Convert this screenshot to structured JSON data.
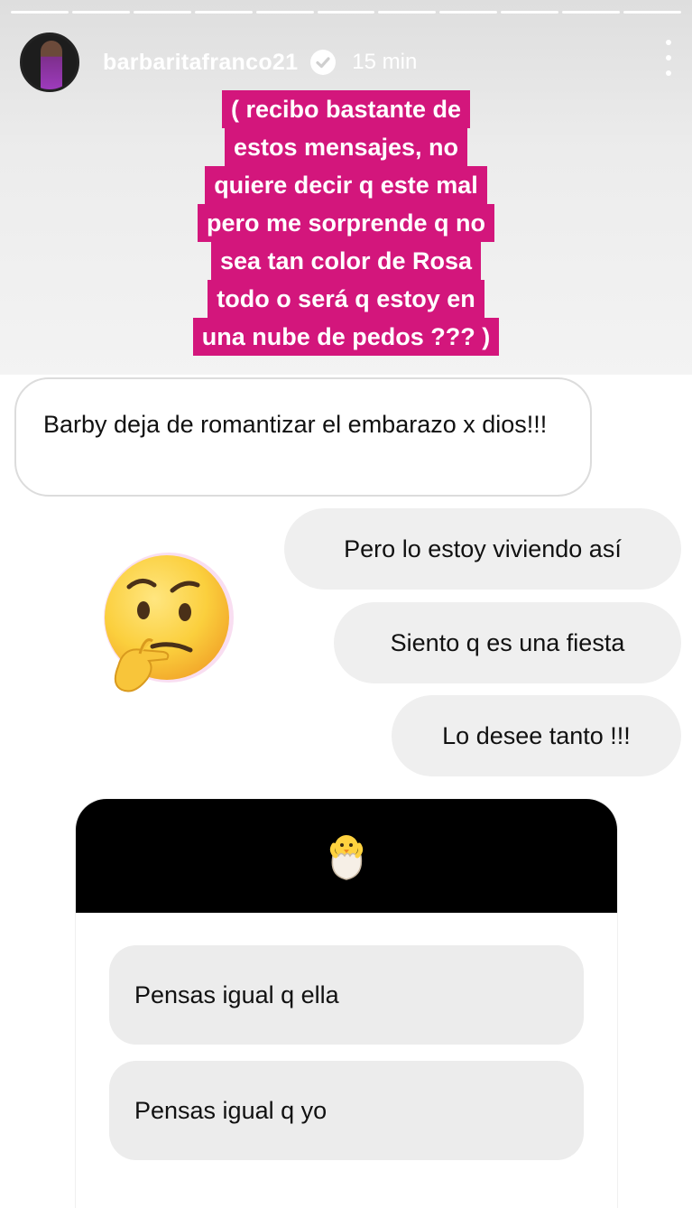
{
  "story": {
    "segments": 11,
    "username": "barbaritafranco21",
    "time_ago": "15 min",
    "icons": {
      "verified": "verified-badge-icon",
      "more": "more-options-icon"
    }
  },
  "caption": {
    "lines": [
      "( recibo bastante de",
      "estos mensajes,  no",
      "quiere decir q este mal",
      "pero me sorprende q no",
      "sea tan color de Rosa",
      "todo o será q estoy en",
      "una nube de pedos ??? )"
    ],
    "background_color": "#d3167c"
  },
  "chat": {
    "incoming": "Barby deja de romantizar el embarazo x dios!!!",
    "outgoing": [
      "Pero lo estoy viviendo así",
      "Siento q es una fiesta",
      "Lo desee tanto !!!"
    ],
    "emoji": "thinking-face-icon"
  },
  "question_sticker": {
    "emoji": "hatching-chick-icon",
    "answers": [
      "Pensas igual q ella",
      "Pensas igual q yo"
    ]
  }
}
